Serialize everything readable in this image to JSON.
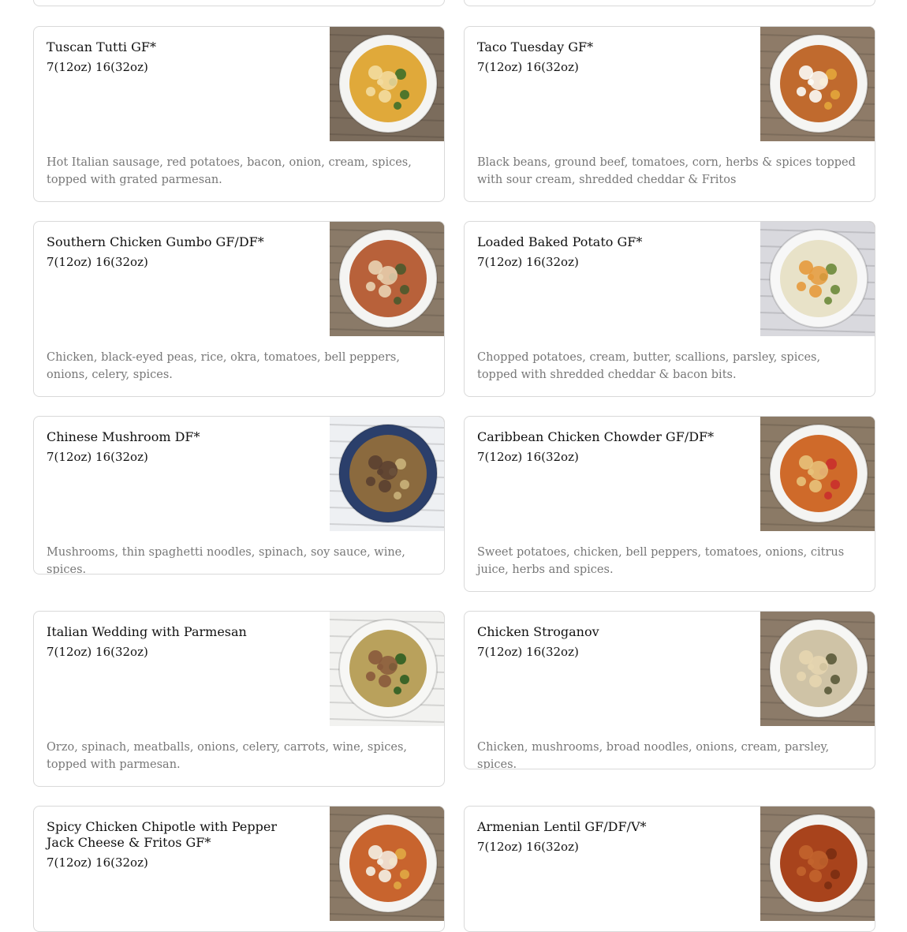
{
  "cards": [
    {
      "title": "Tuscan Tutti GF*",
      "price": "7(12oz) 16(32oz)",
      "description": "Hot Italian sausage, red potatoes, bacon, onion, cream, spices, topped with grated parmesan.",
      "image": "soup-photo-tuscan-tutti",
      "colors": {
        "table": "#7b6c5c",
        "bowl": "#f4f4f2",
        "soup": "#e0a93a",
        "accent": "#3f6f2a",
        "topping": "#f3dca0"
      }
    },
    {
      "title": "Taco Tuesday GF*",
      "price": "7(12oz) 16(32oz)",
      "description": "Black beans, ground beef, tomatoes, corn, herbs & spices topped with sour cream, shredded cheddar & Fritos",
      "image": "soup-photo-taco-tuesday",
      "colors": {
        "table": "#8e7b68",
        "bowl": "#f5f5f3",
        "soup": "#c06a2e",
        "accent": "#e3a63b",
        "topping": "#fbfbf6"
      }
    },
    {
      "title": "Southern Chicken Gumbo GF/DF*",
      "price": "7(12oz) 16(32oz)",
      "description": "Chicken, black-eyed peas, rice, okra, tomatoes, bell peppers, onions, celery, spices.",
      "image": "soup-photo-southern-chicken-gumbo",
      "colors": {
        "table": "#8a7a68",
        "bowl": "#f4f4f2",
        "soup": "#b8613a",
        "accent": "#4b5a2e",
        "topping": "#e9d3b3"
      }
    },
    {
      "title": "Loaded Baked Potato GF*",
      "price": "7(12oz) 16(32oz)",
      "description": "Chopped potatoes, cream, butter, scallions, parsley, spices, topped with shredded cheddar & bacon bits.",
      "image": "soup-photo-loaded-baked-potato",
      "colors": {
        "table": "#d9d9de",
        "bowl": "#f7f7f7",
        "soup": "#e8e2c8",
        "accent": "#6b8a3a",
        "topping": "#e59a3c"
      }
    },
    {
      "title": "Chinese Mushroom DF*",
      "price": "7(12oz) 16(32oz)",
      "description": "Mushrooms, thin spaghetti noodles, spinach, soy sauce, wine, spices.",
      "image": "soup-photo-chinese-mushroom",
      "colors": {
        "table": "#eef0f3",
        "bowl": "#2b3f6b",
        "soup": "#8b6a3e",
        "accent": "#c9b27a",
        "topping": "#5a4030"
      }
    },
    {
      "title": "Caribbean Chicken Chowder GF/DF*",
      "price": "7(12oz) 16(32oz)",
      "description": "Sweet potatoes, chicken, bell peppers, tomatoes, onions, citrus juice, herbs and spices.",
      "image": "soup-photo-caribbean-chicken-chowder",
      "colors": {
        "table": "#8b7a66",
        "bowl": "#f4f4f2",
        "soup": "#cf6a2a",
        "accent": "#c9302c",
        "topping": "#e7c27a"
      }
    },
    {
      "title": "Italian Wedding with Parmesan",
      "price": "7(12oz) 16(32oz)",
      "description": "Orzo, spinach, meatballs, onions, celery, carrots, wine, spices, topped with parmesan.",
      "image": "soup-photo-italian-wedding",
      "colors": {
        "table": "#f2f2f0",
        "bowl": "#f7f7f5",
        "soup": "#b9a15c",
        "accent": "#2f5e22",
        "topping": "#8a5a3c"
      }
    },
    {
      "title": "Chicken Stroganov",
      "price": "7(12oz) 16(32oz)",
      "description": "Chicken, mushrooms, broad noodles, onions, cream, parsley, spices.",
      "image": "soup-photo-chicken-stroganov",
      "colors": {
        "table": "#8c7b69",
        "bowl": "#f6f6f4",
        "soup": "#cfc3a6",
        "accent": "#5a5a3a",
        "topping": "#e6d6b0"
      }
    },
    {
      "title": "Spicy Chicken Chipotle with Pepper Jack Cheese & Fritos GF*",
      "price": "7(12oz) 16(32oz)",
      "description": "",
      "image": "soup-photo-spicy-chicken-chipotle",
      "colors": {
        "table": "#8a7966",
        "bowl": "#f4f4f2",
        "soup": "#c8642e",
        "accent": "#e0a844",
        "topping": "#f4efe4"
      }
    },
    {
      "title": "Armenian Lentil GF/DF/V*",
      "price": "7(12oz) 16(32oz)",
      "description": "",
      "image": "soup-photo-armenian-lentil",
      "colors": {
        "table": "#8d7c6a",
        "bowl": "#f4f4f2",
        "soup": "#a8431c",
        "accent": "#7a2e12",
        "topping": "#c2642e"
      }
    }
  ]
}
